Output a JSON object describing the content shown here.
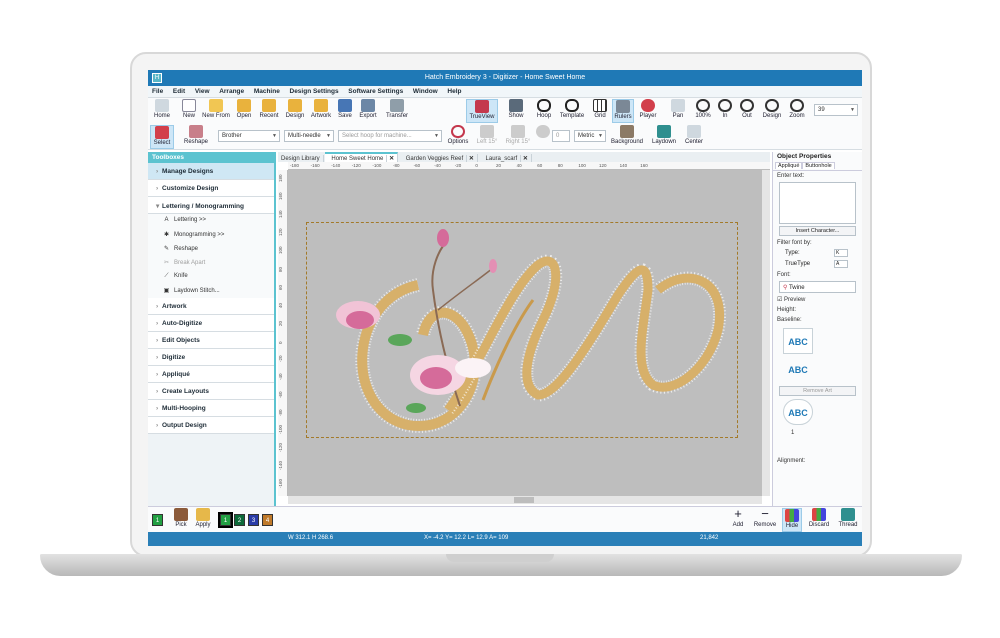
{
  "window": {
    "title": "Hatch Embroidery 3 - Digitizer - Home Sweet Home",
    "logo_text": "H"
  },
  "menu": [
    "File",
    "Edit",
    "View",
    "Arrange",
    "Machine",
    "Design Settings",
    "Software Settings",
    "Window",
    "Help"
  ],
  "toolbar_top": [
    "Home",
    "New",
    "New From",
    "Open",
    "Recent",
    "Design",
    "Artwork",
    "Save",
    "Export",
    "Transfer",
    "TrueView",
    "Show",
    "Hoop",
    "Template",
    "Grid",
    "Rulers",
    "Player",
    "Pan",
    "100%",
    "In",
    "Out",
    "Design",
    "Zoom"
  ],
  "zoom_value": "39",
  "toolbar_second": {
    "select": "Select",
    "reshape": "Reshape",
    "fabric": "Brother",
    "machine": "Multi-needle",
    "hoop_placeholder": "Select hoop for machine...",
    "options": "Options",
    "left": "Left 15°",
    "right": "Right 15°",
    "angle": "0",
    "units": "Metric",
    "background": "Background",
    "laydown": "Laydown",
    "center": "Center"
  },
  "toolboxes": {
    "title": "Toolboxes",
    "sections_top": [
      "Manage Designs",
      "Customize Design",
      "Lettering / Monogramming"
    ],
    "lettering_items": [
      {
        "label": "Lettering >>",
        "icon": "A",
        "disabled": false
      },
      {
        "label": "Monogramming >>",
        "icon": "✱",
        "disabled": false
      },
      {
        "label": "Reshape",
        "icon": "✎",
        "disabled": false
      },
      {
        "label": "Break Apart",
        "icon": "✂",
        "disabled": true
      },
      {
        "label": "Knife",
        "icon": "⟋",
        "disabled": false
      },
      {
        "label": "Laydown Stitch...",
        "icon": "▣",
        "disabled": false
      }
    ],
    "sections_bottom": [
      "Artwork",
      "Auto-Digitize",
      "Edit Objects",
      "Digitize",
      "Appliqué",
      "Create Layouts",
      "Multi-Hooping",
      "Output Design"
    ]
  },
  "doc_tabs": [
    "Design Library",
    "Home Sweet Home",
    "Garden Veggies Reef",
    "Laura_scarf"
  ],
  "ruler_top_labels": [
    "-180",
    "-160",
    "-140",
    "-120",
    "-100",
    "-80",
    "-60",
    "-40",
    "-20",
    "0",
    "20",
    "40",
    "60",
    "80",
    "100",
    "120",
    "140",
    "160"
  ],
  "ruler_left_labels": [
    "180",
    "160",
    "140",
    "120",
    "100",
    "80",
    "60",
    "40",
    "20",
    "0",
    "-20",
    "-40",
    "-60",
    "-80",
    "-100",
    "-120",
    "-140",
    "-160"
  ],
  "object_properties": {
    "title": "Object Properties",
    "tabs": [
      "Appliqué",
      "Buttonhole"
    ],
    "enter_text": "Enter text:",
    "insert_character": "Insert Character...",
    "filter_font": "Filter font by:",
    "type_label": "Type:",
    "type_value": "K",
    "truetype_label": "TrueType",
    "truetype_value": "A",
    "font_label": "Font:",
    "font_value": "Twine",
    "preview_label": "Preview",
    "height_label": "Height:",
    "baseline_label": "Baseline:",
    "baseline_sample": "ABC",
    "remove_art": "Remove Art",
    "number_label": "1",
    "alignment_label": "Alignment:"
  },
  "bottom_toolbar": {
    "pick": "Pick",
    "apply": "Apply",
    "swatches": [
      "1",
      "1",
      "2",
      "3",
      "4"
    ],
    "add": "Add",
    "remove": "Remove",
    "hide": "Hide",
    "discard": "Discard",
    "thread": "Thread"
  },
  "status": {
    "size": "W 312.1 H 268.6",
    "coords": "X= -4.2 Y= 12.2 L= 12.9 A= 109",
    "stitches": "21,842"
  },
  "colors": {
    "accent": "#5cc3d0",
    "title_blue": "#1f79b6",
    "gold": "#d7b06a",
    "pink": "#e48fb4"
  }
}
